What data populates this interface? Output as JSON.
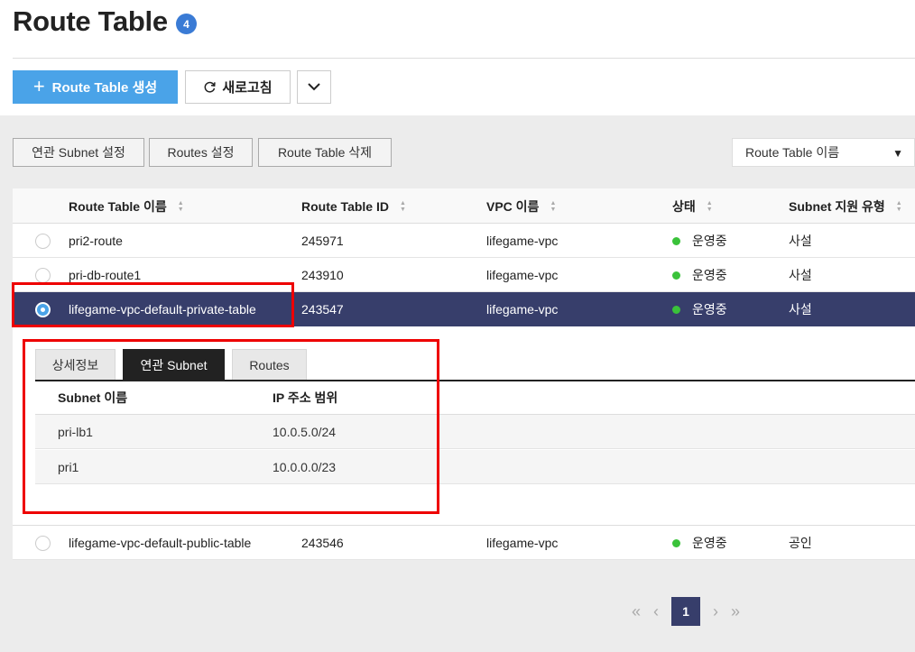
{
  "header": {
    "title": "Route Table",
    "count": "4",
    "create_label": "Route Table 생성",
    "refresh_label": "새로고침"
  },
  "actions": {
    "assoc_subnet": "연관 Subnet 설정",
    "routes": "Routes 설정",
    "delete": "Route Table 삭제"
  },
  "filter": {
    "selected": "Route Table 이름"
  },
  "table": {
    "columns": [
      "Route Table 이름",
      "Route Table ID",
      "VPC 이름",
      "상태",
      "Subnet 지원 유형"
    ],
    "rows": [
      {
        "name": "pri2-route",
        "id": "245971",
        "vpc": "lifegame-vpc",
        "status": "운영중",
        "type": "사설"
      },
      {
        "name": "pri-db-route1",
        "id": "243910",
        "vpc": "lifegame-vpc",
        "status": "운영중",
        "type": "사설"
      },
      {
        "name": "lifegame-vpc-default-private-table",
        "id": "243547",
        "vpc": "lifegame-vpc",
        "status": "운영중",
        "type": "사설"
      },
      {
        "name": "lifegame-vpc-default-public-table",
        "id": "243546",
        "vpc": "lifegame-vpc",
        "status": "운영중",
        "type": "공인"
      }
    ]
  },
  "detail": {
    "tabs": [
      "상세정보",
      "연관 Subnet",
      "Routes"
    ],
    "active_tab": "연관 Subnet",
    "columns": [
      "Subnet 이름",
      "IP 주소 범위"
    ],
    "rows": [
      {
        "name": "pri-lb1",
        "range": "10.0.5.0/24"
      },
      {
        "name": "pri1",
        "range": "10.0.0.0/23"
      }
    ]
  },
  "pagination": {
    "current": "1"
  },
  "colors": {
    "accent": "#4aa3e8",
    "selected_row": "#373e6b",
    "status_ok": "#3ac23a",
    "highlight": "#e00000"
  }
}
